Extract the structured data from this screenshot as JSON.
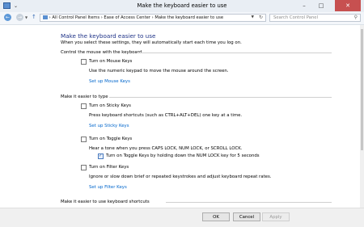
{
  "window": {
    "title": "Make the keyboard easier to use",
    "minimize": "–",
    "maximize": "□",
    "close": "✕"
  },
  "navbar": {
    "back_glyph": "←",
    "forward_glyph": "→",
    "up_glyph": "↑",
    "breadcrumbs": [
      "All Control Panel Items",
      "Ease of Access Center",
      "Make the keyboard easier to use"
    ],
    "separator": "›",
    "search_placeholder": "Search Control Panel"
  },
  "page": {
    "title": "Make the keyboard easier to use",
    "subtitle": "When you select these settings, they will automatically start each time you log on."
  },
  "sections": {
    "mouse": {
      "heading": "Control the mouse with the keyboard",
      "mouse_keys": {
        "label": "Turn on Mouse Keys",
        "checked": false,
        "description": "Use the numeric keypad to move the mouse around the screen.",
        "setup_link": "Set up Mouse Keys"
      }
    },
    "typing": {
      "heading": "Make it easier to type",
      "sticky_keys": {
        "label": "Turn on Sticky Keys",
        "checked": false,
        "description": "Press keyboard shortcuts (such as CTRL+ALT+DEL) one key at a time.",
        "setup_link": "Set up Sticky Keys"
      },
      "toggle_keys": {
        "label": "Turn on Toggle Keys",
        "checked": false,
        "description": "Hear a tone when you press CAPS LOCK, NUM LOCK, or SCROLL LOCK.",
        "sub_option_label": "Turn on Toggle Keys by holding down the NUM LOCK key for 5 seconds",
        "sub_option_checked": true
      },
      "filter_keys": {
        "label": "Turn on Filter Keys",
        "checked": false,
        "description": "Ignore or slow down brief or repeated keystrokes and adjust keyboard repeat rates.",
        "setup_link": "Set up Filter Keys"
      }
    },
    "shortcuts": {
      "heading": "Make it easier to use keyboard shortcuts"
    }
  },
  "footer": {
    "ok": "OK",
    "cancel": "Cancel",
    "apply": "Apply"
  }
}
